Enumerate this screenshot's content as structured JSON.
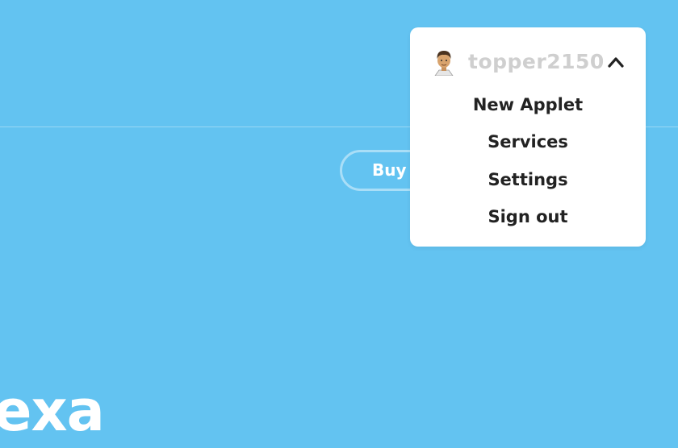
{
  "page": {
    "background_color": "#63c3f1"
  },
  "hero": {
    "buy_label": "Buy",
    "title_fragment": "exa"
  },
  "user_menu": {
    "username": "topper2150",
    "avatar_icon": "bitmoji-avatar-icon",
    "toggle_icon": "chevron-up-icon",
    "items": [
      {
        "label": "New Applet"
      },
      {
        "label": "Services"
      },
      {
        "label": "Settings"
      },
      {
        "label": "Sign out"
      }
    ]
  }
}
